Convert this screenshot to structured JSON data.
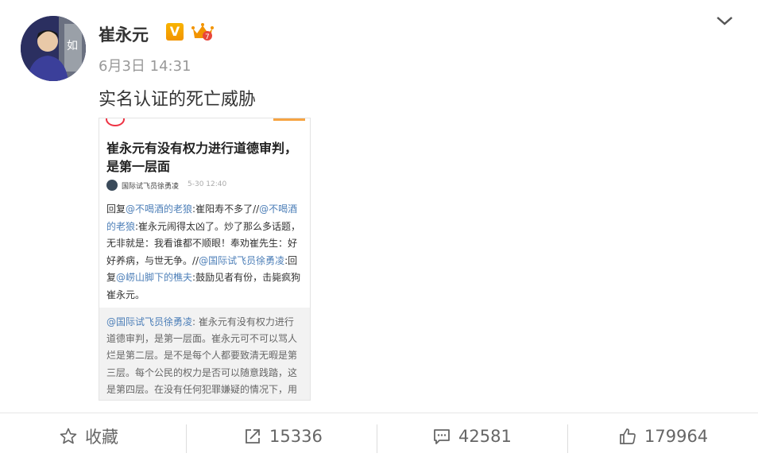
{
  "post": {
    "author": "崔永元",
    "verified_badge": "V",
    "time": "6月3日 14:31",
    "text": "实名认证的死亡威胁"
  },
  "card": {
    "title_lines": [
      "崔永元有没有权力进行道德审判，",
      "是第一层面"
    ],
    "author": "国际试飞员徐勇凌",
    "time": "5-30 12:40",
    "body_lines": [
      [
        "回复",
        "@不喝酒的老狼",
        ":崔阳寿不多了//",
        "@不喝酒"
      ],
      [
        "的老狼",
        ":崔永元闹得太凶了。炒了那么多话题，"
      ],
      [
        "无非就是：我看谁都不顺眼！奉劝崔先生：好"
      ],
      [
        "好养病，与世无争。//",
        "@国际试飞员徐勇凌",
        ":回"
      ],
      [
        "复",
        "@崂山脚下的樵夫",
        ":鼓励见者有份，击毙疯狗"
      ],
      [
        "崔永元。"
      ]
    ],
    "quote_lines": [
      [
        "@国际试飞员徐勇凌",
        ": 崔永元有没有权力进行"
      ],
      [
        "道德审判，是第一层面。崔永元可不可以骂人"
      ],
      [
        "烂是第二层。是不是每个人都要致清无暇是第"
      ],
      [
        "三层。每个公民的权力是否可以随意践踏，这"
      ],
      [
        "是第四层。在没有任何犯罪嫌疑的情况下，用"
      ]
    ]
  },
  "actions": {
    "favorite": "收藏",
    "repost": "15336",
    "comment": "42581",
    "like": "179964"
  },
  "colors": {
    "link": "#4d7fb8",
    "vip": "#f29400",
    "text": "#333333",
    "muted": "#999999"
  }
}
